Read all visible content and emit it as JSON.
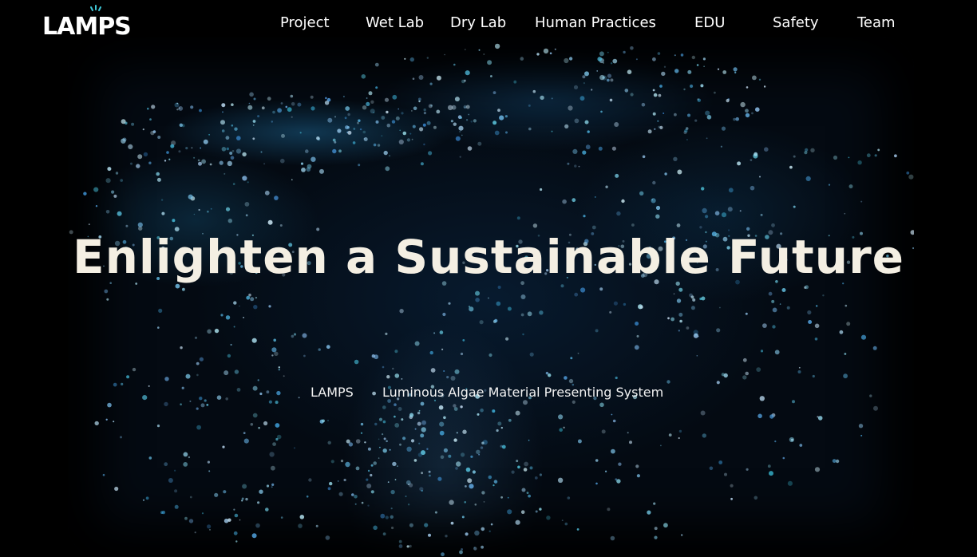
{
  "logo": {
    "text": "LAMPS",
    "accent_color": "#3fc8d8"
  },
  "nav": {
    "items": [
      {
        "label": "Project"
      },
      {
        "label": "Wet Lab"
      },
      {
        "label": "Dry Lab"
      },
      {
        "label": "Human Practices"
      },
      {
        "label": "EDU"
      },
      {
        "label": "Safety"
      },
      {
        "label": "Team"
      }
    ]
  },
  "hero": {
    "headline": "Enlighten a Sustainable Future",
    "acronym": "LAMPS",
    "tagline": "Luminous Algae Material Presenting System",
    "background_color": "#000000",
    "glow_color": "#2a9ad0"
  }
}
